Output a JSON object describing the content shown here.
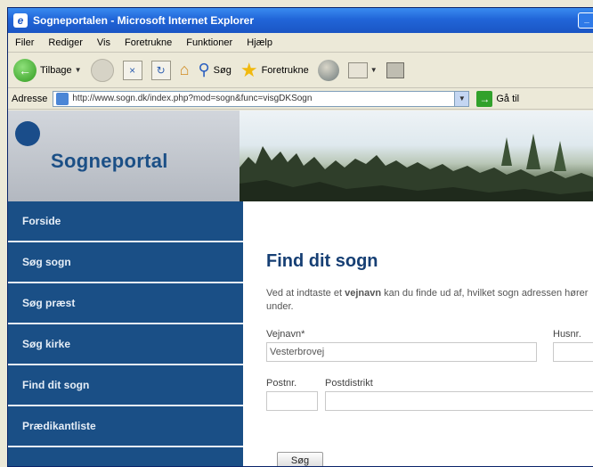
{
  "window": {
    "title": "Sogneportalen - Microsoft Internet Explorer"
  },
  "menu": [
    "Filer",
    "Rediger",
    "Vis",
    "Foretrukne",
    "Funktioner",
    "Hjælp"
  ],
  "toolbar": {
    "back_label": "Tilbage",
    "search_label": "Søg",
    "favorites_label": "Foretrukne"
  },
  "address": {
    "label": "Adresse",
    "url": "http://www.sogn.dk/index.php?mod=sogn&func=visgDKSogn",
    "go_label": "Gå til"
  },
  "logo": {
    "text": "Sogneportal"
  },
  "nav": [
    "Forside",
    "Søg sogn",
    "Søg præst",
    "Søg kirke",
    "Find dit sogn",
    "Prædikantliste"
  ],
  "page": {
    "title": "Find dit sogn",
    "intro_prefix": "Ved at indtaste et ",
    "intro_bold": "vejnavn",
    "intro_suffix": " kan du finde ud af, hvilket sogn adressen hører under.",
    "vejnavn_label": "Vejnavn*",
    "vejnavn_value": "Vesterbrovej",
    "husnr_label": "Husnr.",
    "postnr_label": "Postnr.",
    "postdistrikt_label": "Postdistrikt",
    "submit_label": "Søg"
  }
}
